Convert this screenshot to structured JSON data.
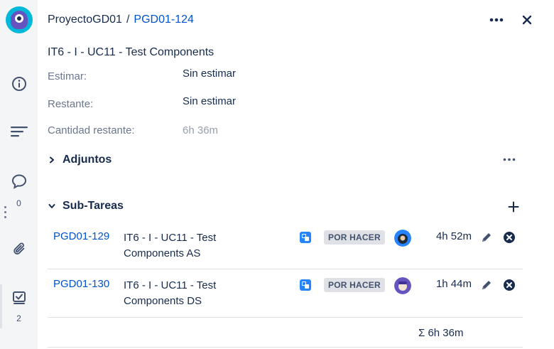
{
  "rail": {
    "comments_count": "0",
    "subtasks_count": "2"
  },
  "header": {
    "project": "ProyectoGD01",
    "separator": "/",
    "issue_key": "PGD01-124"
  },
  "issue": {
    "title": "IT6 - I - UC11 - Test Components"
  },
  "fields": [
    {
      "label": "Estimar:",
      "value": "Sin estimar"
    },
    {
      "label": "Restante:",
      "value": "Sin estimar"
    },
    {
      "label": "Cantidad restante:",
      "value": "6h 36m"
    }
  ],
  "sections": {
    "attachments": "Adjuntos",
    "subtasks": "Sub-Tareas"
  },
  "subtasks": [
    {
      "key": "PGD01-129",
      "summary": "IT6 - I - UC11 - Test Components AS",
      "status": "POR HACER",
      "time": "4h 52m"
    },
    {
      "key": "PGD01-130",
      "summary": "IT6 - I - UC11 - Test Components DS",
      "status": "POR HACER",
      "time": "1h 44m"
    }
  ],
  "total": "Σ 6h 36m",
  "colors": {
    "link": "#0052cc",
    "text": "#172b4d",
    "muted": "#6b778c",
    "status_bg": "#dfe1e6",
    "logo": "#00b8d9"
  }
}
